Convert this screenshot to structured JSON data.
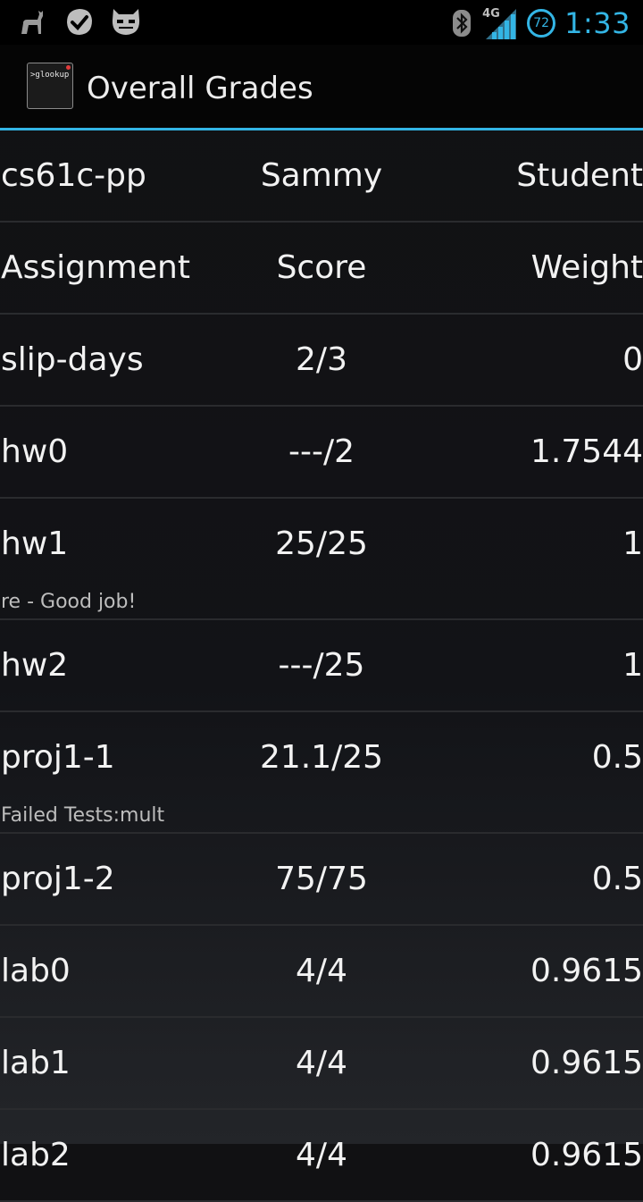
{
  "status_bar": {
    "left_icons": [
      "llama-icon",
      "checkmark-icon",
      "robot-icon"
    ],
    "network_label": "4G",
    "battery_level": "72",
    "time": "1:33",
    "accent_color": "#33b5e5"
  },
  "action_bar": {
    "app_icon_text": ">glookup",
    "title": "Overall Grades"
  },
  "info_row": [
    "cs61c-pp",
    "Sammy",
    "Student"
  ],
  "header_row": [
    "Assignment",
    "Score",
    "Weight"
  ],
  "rows": [
    {
      "assignment": "slip-days",
      "score": "2/3",
      "weight": "0",
      "note": ""
    },
    {
      "assignment": "hw0",
      "score": "---/2",
      "weight": "1.7544",
      "note": ""
    },
    {
      "assignment": "hw1",
      "score": "25/25",
      "weight": "1",
      "note": "re - Good job!"
    },
    {
      "assignment": "hw2",
      "score": "---/25",
      "weight": "1",
      "note": ""
    },
    {
      "assignment": "proj1-1",
      "score": "21.1/25",
      "weight": "0.5",
      "note": "Failed Tests:mult"
    },
    {
      "assignment": "proj1-2",
      "score": "75/75",
      "weight": "0.5",
      "note": ""
    },
    {
      "assignment": "lab0",
      "score": "4/4",
      "weight": "0.9615",
      "note": ""
    },
    {
      "assignment": "lab1",
      "score": "4/4",
      "weight": "0.9615",
      "note": ""
    },
    {
      "assignment": "lab2",
      "score": "4/4",
      "weight": "0.9615",
      "note": ""
    }
  ]
}
